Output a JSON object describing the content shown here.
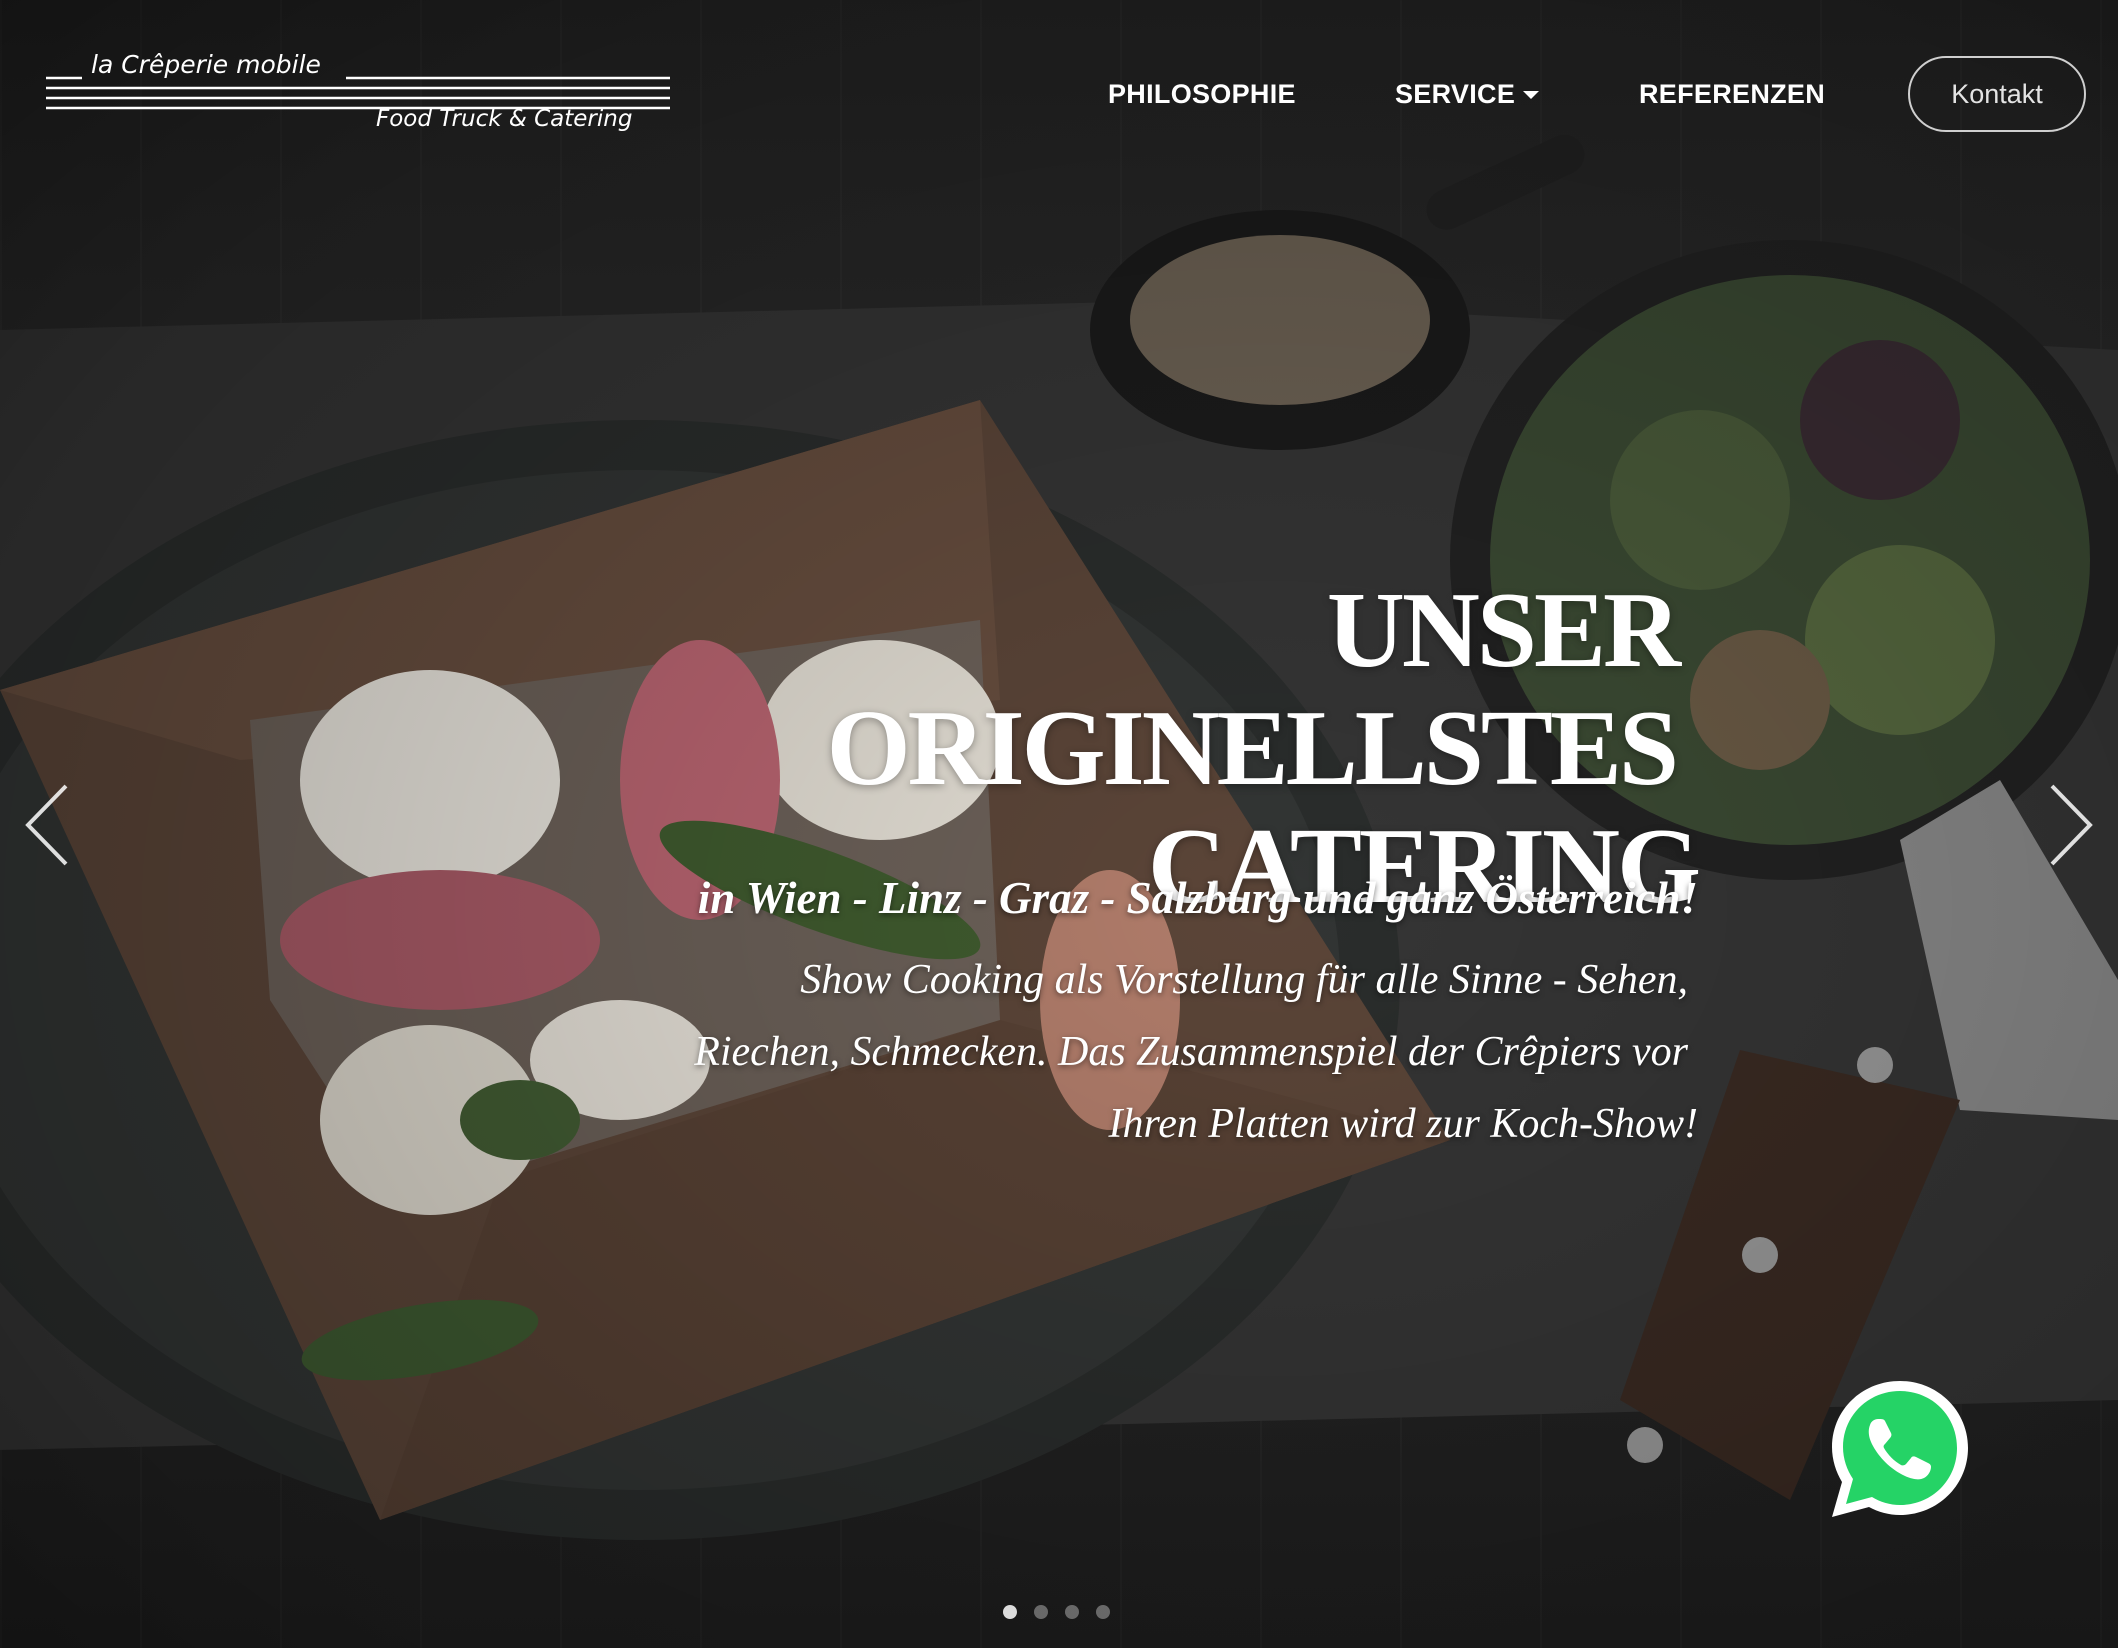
{
  "header": {
    "logo": {
      "name": "la Crêperie mobile",
      "tagline": "Food Truck & Catering"
    },
    "nav": {
      "philosophie": "PHILOSOPHIE",
      "service": "SERVICE",
      "referenzen": "REFERENZEN"
    },
    "contact_label": "Kontakt"
  },
  "hero": {
    "title_line1": "UNSER",
    "title_line2": "ORIGINELLSTES",
    "title_line3": "CATERING",
    "subtitle": "in Wien - Linz - Graz - Salzburg und ganz Österreich!",
    "description_line1": "Show Cooking als Vorstellung für alle Sinne - Sehen,",
    "description_line2": "Riechen, Schmecken. Das Zusammenspiel der Crêpiers vor",
    "description_line3": "Ihren Platten wird zur Koch-Show!",
    "background_image": "buckwheat galette with figs, goat cheese and salad on dark slate"
  },
  "slider": {
    "active_index": 0,
    "slide_count": 4
  },
  "icons": {
    "prev": "chevron-left-icon",
    "next": "chevron-right-icon",
    "chat": "whatsapp-icon"
  },
  "colors": {
    "text": "#ffffff",
    "whatsapp_green": "#25d366",
    "button_border": "#cfcfcf"
  }
}
